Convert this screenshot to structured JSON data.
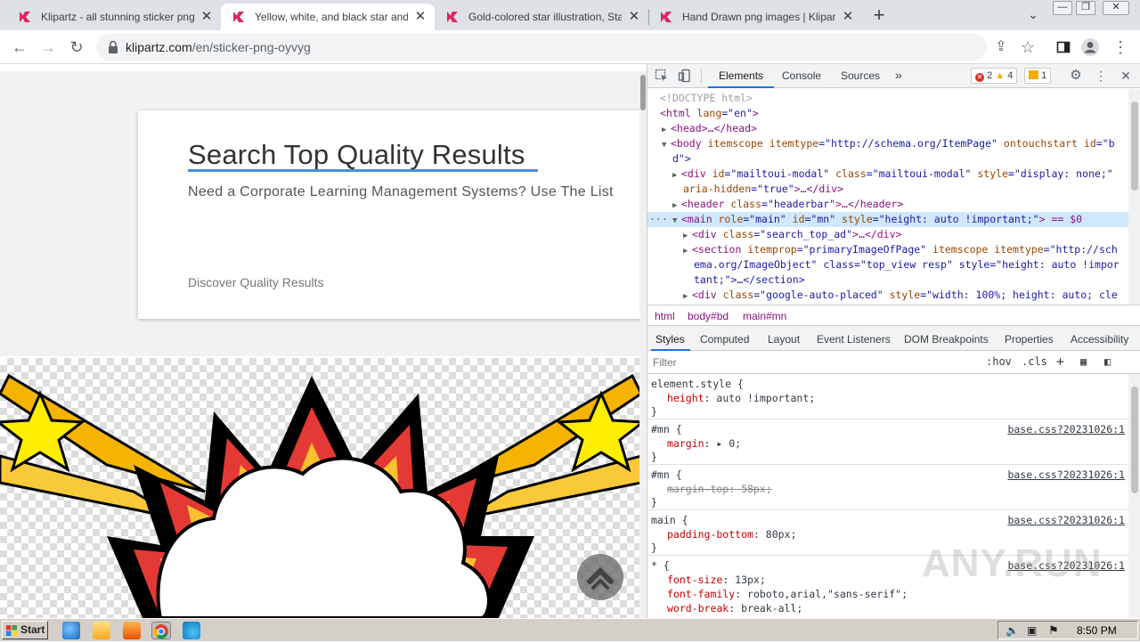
{
  "browser": {
    "tabs": [
      {
        "title": "Klipartz - all stunning sticker png ima",
        "active": false
      },
      {
        "title": "Yellow, white, and black star and clo",
        "active": true
      },
      {
        "title": "Gold-colored star illustration, Star Dr",
        "active": false
      },
      {
        "title": "Hand Drawn png images | Klipartz",
        "active": false
      }
    ],
    "new_tab_label": "+",
    "url_host": "klipartz.com",
    "url_path": "/en/sticker-png-oyvyg"
  },
  "page": {
    "card_title": "Search Top Quality Results",
    "card_subtitle": "Need a Corporate Learning Management Systems? Use The List",
    "card_link": "Discover Quality Results"
  },
  "devtools": {
    "tabs": [
      "Elements",
      "Console",
      "Sources",
      "»"
    ],
    "active_tab": "Elements",
    "badges": {
      "errors": "2",
      "warnings": "4",
      "issues": "1"
    },
    "dom_lines": {
      "l1": "<!DOCTYPE html>",
      "l2a": "<html ",
      "l2b": "lang",
      "l2c": "=\"en\"",
      "l2d": ">",
      "l3": "<head>…</head>",
      "l4a": "<body ",
      "l4b": "itemscope itemtype",
      "l4c": "=\"http://schema.org/ItemPage\"",
      "l4d": " ontouchstart id",
      "l4e": "=\"b",
      "l5": "d\">",
      "l6a": "<div ",
      "l6b": "id",
      "l6c": "=\"mailtoui-modal\"",
      "l6d": " class",
      "l6e": "=\"mailtoui-modal\"",
      "l6f": " style",
      "l6g": "=\"display: none;\"",
      "l7a": "aria-hidden",
      "l7b": "=\"true\"",
      "l7c": ">…</div>",
      "l8a": "<header ",
      "l8b": "class",
      "l8c": "=\"headerbar\"",
      "l8d": ">…</header>",
      "l9a": "<main ",
      "l9b": "role",
      "l9c": "=\"main\"",
      "l9d": " id",
      "l9e": "=\"mn\"",
      "l9f": " style",
      "l9g": "=\"height: auto !important;\"",
      "l9h": "> == $0",
      "l10a": "<div ",
      "l10b": "class",
      "l10c": "=\"search_top_ad\"",
      "l10d": ">…</div>",
      "l11a": "<section ",
      "l11b": "itemprop",
      "l11c": "=\"primaryImageOfPage\"",
      "l11d": " itemscope itemtype",
      "l11e": "=\"http://sch",
      "l12": "ema.org/ImageObject\" class=\"top_view resp\" style=\"height: auto !impor",
      "l13": "tant;\">…</section>",
      "l14a": "<div ",
      "l14b": "class",
      "l14c": "=\"google-auto-placed\"",
      "l14d": " style",
      "l14e": "=\"width: 100%; height: auto; cle"
    },
    "breadcrumbs": [
      "html",
      "body#bd",
      "main#mn"
    ],
    "panel_tabs": [
      "Styles",
      "Computed",
      "Layout",
      "Event Listeners",
      "DOM Breakpoints",
      "Properties",
      "Accessibility"
    ],
    "filter_placeholder": "Filter",
    "filter_tools": [
      ":hov",
      ".cls",
      "+"
    ],
    "styles": {
      "r1_sel": "element.style {",
      "r1_p1n": "height",
      "r1_p1v": ": auto !important;",
      "r1_end": "}",
      "r2_sel": "#mn {",
      "r2_src": "base.css?20231026:1",
      "r2_p1n": "margin",
      "r2_p1v": ": ▸ 0;",
      "r2_end": "}",
      "r3_sel": "#mn {",
      "r3_src": "base.css?20231026:1",
      "r3_p1": "margin-top: 58px;",
      "r3_end": "}",
      "r4_sel": "main {",
      "r4_src": "base.css?20231026:1",
      "r4_p1n": "padding-bottom",
      "r4_p1v": ": 80px;",
      "r4_end": "}",
      "r5_sel": "* {",
      "r5_src": "base.css?20231026:1",
      "r5_p1n": "font-size",
      "r5_p1v": ": 13px;",
      "r5_p2n": "font-family",
      "r5_p2v": ": roboto,arial,\"sans-serif\";",
      "r5_p3n": "word-break",
      "r5_p3v": ": break-all;"
    }
  },
  "watermark": "ANY.RUN",
  "taskbar": {
    "start_label": "Start",
    "clock": "8:50 PM"
  },
  "colors": {
    "accent": "#1a73e8",
    "title_underline": "#4a8fd6",
    "tag": "#881280",
    "attr_name": "#994500",
    "attr_value": "#1a1aa6",
    "favicon": "#e0245e"
  }
}
